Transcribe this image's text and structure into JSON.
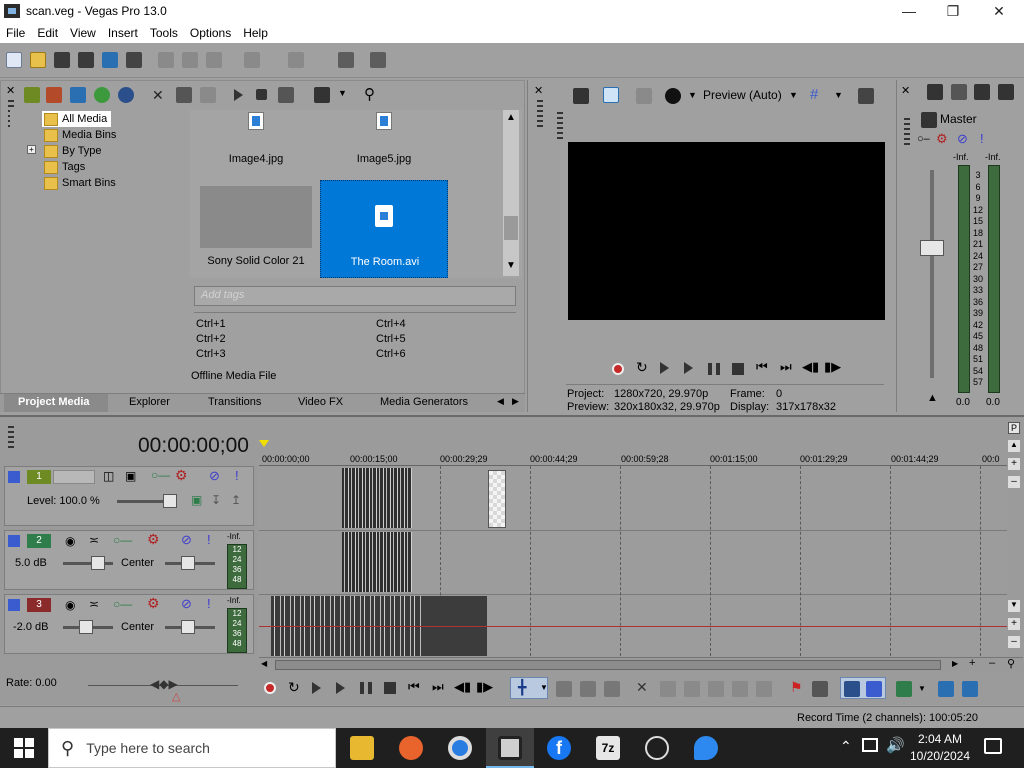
{
  "window": {
    "title": "scan.veg - Vegas Pro 13.0"
  },
  "menu": [
    "File",
    "Edit",
    "View",
    "Insert",
    "Tools",
    "Options",
    "Help"
  ],
  "tree": {
    "items": [
      "All Media",
      "Media Bins",
      "By Type",
      "Tags",
      "Smart Bins"
    ]
  },
  "media": {
    "files": [
      {
        "name": "Image4.jpg"
      },
      {
        "name": "Image5.jpg"
      },
      {
        "name": "Sony Solid Color 21"
      },
      {
        "name": "The Room.avi",
        "selected": true
      }
    ],
    "tag_placeholder": "Add tags",
    "shortcuts": [
      "Ctrl+1",
      "Ctrl+4",
      "Ctrl+2",
      "Ctrl+5",
      "Ctrl+3",
      "Ctrl+6"
    ],
    "status": "Offline Media File"
  },
  "tabs": [
    "Project Media",
    "Explorer",
    "Transitions",
    "Video FX",
    "Media Generators"
  ],
  "preview": {
    "mode": "Preview (Auto)",
    "project_label": "Project:",
    "project_value": "1280x720, 29.970p",
    "preview_label": "Preview:",
    "preview_value": "320x180x32, 29.970p",
    "frame_label": "Frame:",
    "frame_value": "0",
    "display_label": "Display:",
    "display_value": "317x178x32"
  },
  "master": {
    "title": "Master",
    "left_peak": "-Inf.",
    "right_peak": "-Inf.",
    "scale": [
      "3",
      "6",
      "9",
      "12",
      "15",
      "18",
      "21",
      "24",
      "27",
      "30",
      "33",
      "36",
      "39",
      "42",
      "45",
      "48",
      "51",
      "54",
      "57"
    ],
    "left_value": "0.0",
    "right_value": "0.0"
  },
  "timeline": {
    "timecode": "00:00:00;00",
    "ruler": [
      "00:00:00;00",
      "00:00:15;00",
      "00:00:29;29",
      "00:00:44;29",
      "00:00:59;28",
      "00:01:15;00",
      "00:01:29;29",
      "00:01:44;29",
      "00:0"
    ],
    "tracks": [
      {
        "num": "1",
        "type": "video",
        "level": "Level: 100.0 %"
      },
      {
        "num": "2",
        "type": "audio",
        "volume": "5.0 dB",
        "pan": "Center",
        "peak": "-Inf.",
        "scale": [
          "12",
          "24",
          "36",
          "48"
        ]
      },
      {
        "num": "3",
        "type": "audio",
        "volume": "-2.0 dB",
        "pan": "Center",
        "peak": "-Inf.",
        "scale": [
          "12",
          "24",
          "36",
          "48"
        ]
      }
    ],
    "rate": "Rate: 0.00"
  },
  "status": {
    "record_time": "Record Time (2 channels): 100:05:20"
  },
  "taskbar": {
    "search_placeholder": "Type here to search",
    "time": "2:04 AM",
    "date": "10/20/2024"
  },
  "colors": {
    "accent": "#0078d7",
    "video_track": "#6e8a23",
    "audio_track2": "#2e7d4a",
    "audio_track3": "#8a2a2a"
  }
}
